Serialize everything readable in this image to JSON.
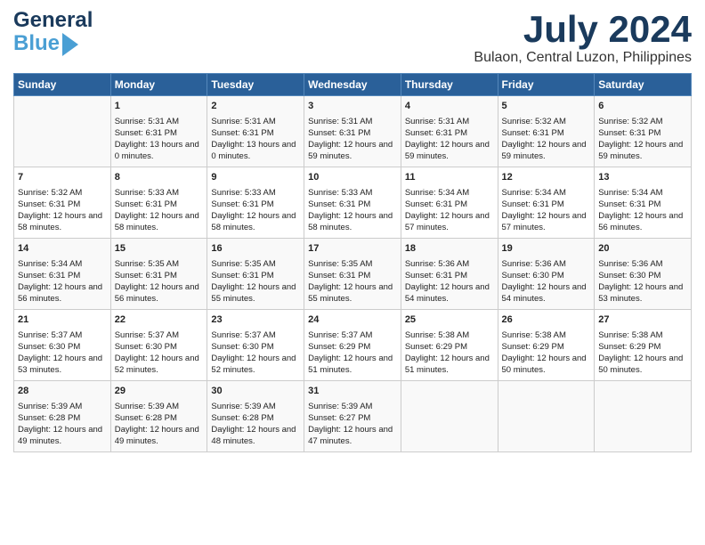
{
  "logo": {
    "general": "General",
    "blue": "Blue"
  },
  "title": "July 2024",
  "subtitle": "Bulaon, Central Luzon, Philippines",
  "weekdays": [
    "Sunday",
    "Monday",
    "Tuesday",
    "Wednesday",
    "Thursday",
    "Friday",
    "Saturday"
  ],
  "weeks": [
    [
      {
        "day": "",
        "sunrise": "",
        "sunset": "",
        "daylight": ""
      },
      {
        "day": "1",
        "sunrise": "Sunrise: 5:31 AM",
        "sunset": "Sunset: 6:31 PM",
        "daylight": "Daylight: 13 hours and 0 minutes."
      },
      {
        "day": "2",
        "sunrise": "Sunrise: 5:31 AM",
        "sunset": "Sunset: 6:31 PM",
        "daylight": "Daylight: 13 hours and 0 minutes."
      },
      {
        "day": "3",
        "sunrise": "Sunrise: 5:31 AM",
        "sunset": "Sunset: 6:31 PM",
        "daylight": "Daylight: 12 hours and 59 minutes."
      },
      {
        "day": "4",
        "sunrise": "Sunrise: 5:31 AM",
        "sunset": "Sunset: 6:31 PM",
        "daylight": "Daylight: 12 hours and 59 minutes."
      },
      {
        "day": "5",
        "sunrise": "Sunrise: 5:32 AM",
        "sunset": "Sunset: 6:31 PM",
        "daylight": "Daylight: 12 hours and 59 minutes."
      },
      {
        "day": "6",
        "sunrise": "Sunrise: 5:32 AM",
        "sunset": "Sunset: 6:31 PM",
        "daylight": "Daylight: 12 hours and 59 minutes."
      }
    ],
    [
      {
        "day": "7",
        "sunrise": "Sunrise: 5:32 AM",
        "sunset": "Sunset: 6:31 PM",
        "daylight": "Daylight: 12 hours and 58 minutes."
      },
      {
        "day": "8",
        "sunrise": "Sunrise: 5:33 AM",
        "sunset": "Sunset: 6:31 PM",
        "daylight": "Daylight: 12 hours and 58 minutes."
      },
      {
        "day": "9",
        "sunrise": "Sunrise: 5:33 AM",
        "sunset": "Sunset: 6:31 PM",
        "daylight": "Daylight: 12 hours and 58 minutes."
      },
      {
        "day": "10",
        "sunrise": "Sunrise: 5:33 AM",
        "sunset": "Sunset: 6:31 PM",
        "daylight": "Daylight: 12 hours and 58 minutes."
      },
      {
        "day": "11",
        "sunrise": "Sunrise: 5:34 AM",
        "sunset": "Sunset: 6:31 PM",
        "daylight": "Daylight: 12 hours and 57 minutes."
      },
      {
        "day": "12",
        "sunrise": "Sunrise: 5:34 AM",
        "sunset": "Sunset: 6:31 PM",
        "daylight": "Daylight: 12 hours and 57 minutes."
      },
      {
        "day": "13",
        "sunrise": "Sunrise: 5:34 AM",
        "sunset": "Sunset: 6:31 PM",
        "daylight": "Daylight: 12 hours and 56 minutes."
      }
    ],
    [
      {
        "day": "14",
        "sunrise": "Sunrise: 5:34 AM",
        "sunset": "Sunset: 6:31 PM",
        "daylight": "Daylight: 12 hours and 56 minutes."
      },
      {
        "day": "15",
        "sunrise": "Sunrise: 5:35 AM",
        "sunset": "Sunset: 6:31 PM",
        "daylight": "Daylight: 12 hours and 56 minutes."
      },
      {
        "day": "16",
        "sunrise": "Sunrise: 5:35 AM",
        "sunset": "Sunset: 6:31 PM",
        "daylight": "Daylight: 12 hours and 55 minutes."
      },
      {
        "day": "17",
        "sunrise": "Sunrise: 5:35 AM",
        "sunset": "Sunset: 6:31 PM",
        "daylight": "Daylight: 12 hours and 55 minutes."
      },
      {
        "day": "18",
        "sunrise": "Sunrise: 5:36 AM",
        "sunset": "Sunset: 6:31 PM",
        "daylight": "Daylight: 12 hours and 54 minutes."
      },
      {
        "day": "19",
        "sunrise": "Sunrise: 5:36 AM",
        "sunset": "Sunset: 6:30 PM",
        "daylight": "Daylight: 12 hours and 54 minutes."
      },
      {
        "day": "20",
        "sunrise": "Sunrise: 5:36 AM",
        "sunset": "Sunset: 6:30 PM",
        "daylight": "Daylight: 12 hours and 53 minutes."
      }
    ],
    [
      {
        "day": "21",
        "sunrise": "Sunrise: 5:37 AM",
        "sunset": "Sunset: 6:30 PM",
        "daylight": "Daylight: 12 hours and 53 minutes."
      },
      {
        "day": "22",
        "sunrise": "Sunrise: 5:37 AM",
        "sunset": "Sunset: 6:30 PM",
        "daylight": "Daylight: 12 hours and 52 minutes."
      },
      {
        "day": "23",
        "sunrise": "Sunrise: 5:37 AM",
        "sunset": "Sunset: 6:30 PM",
        "daylight": "Daylight: 12 hours and 52 minutes."
      },
      {
        "day": "24",
        "sunrise": "Sunrise: 5:37 AM",
        "sunset": "Sunset: 6:29 PM",
        "daylight": "Daylight: 12 hours and 51 minutes."
      },
      {
        "day": "25",
        "sunrise": "Sunrise: 5:38 AM",
        "sunset": "Sunset: 6:29 PM",
        "daylight": "Daylight: 12 hours and 51 minutes."
      },
      {
        "day": "26",
        "sunrise": "Sunrise: 5:38 AM",
        "sunset": "Sunset: 6:29 PM",
        "daylight": "Daylight: 12 hours and 50 minutes."
      },
      {
        "day": "27",
        "sunrise": "Sunrise: 5:38 AM",
        "sunset": "Sunset: 6:29 PM",
        "daylight": "Daylight: 12 hours and 50 minutes."
      }
    ],
    [
      {
        "day": "28",
        "sunrise": "Sunrise: 5:39 AM",
        "sunset": "Sunset: 6:28 PM",
        "daylight": "Daylight: 12 hours and 49 minutes."
      },
      {
        "day": "29",
        "sunrise": "Sunrise: 5:39 AM",
        "sunset": "Sunset: 6:28 PM",
        "daylight": "Daylight: 12 hours and 49 minutes."
      },
      {
        "day": "30",
        "sunrise": "Sunrise: 5:39 AM",
        "sunset": "Sunset: 6:28 PM",
        "daylight": "Daylight: 12 hours and 48 minutes."
      },
      {
        "day": "31",
        "sunrise": "Sunrise: 5:39 AM",
        "sunset": "Sunset: 6:27 PM",
        "daylight": "Daylight: 12 hours and 47 minutes."
      },
      {
        "day": "",
        "sunrise": "",
        "sunset": "",
        "daylight": ""
      },
      {
        "day": "",
        "sunrise": "",
        "sunset": "",
        "daylight": ""
      },
      {
        "day": "",
        "sunrise": "",
        "sunset": "",
        "daylight": ""
      }
    ]
  ]
}
